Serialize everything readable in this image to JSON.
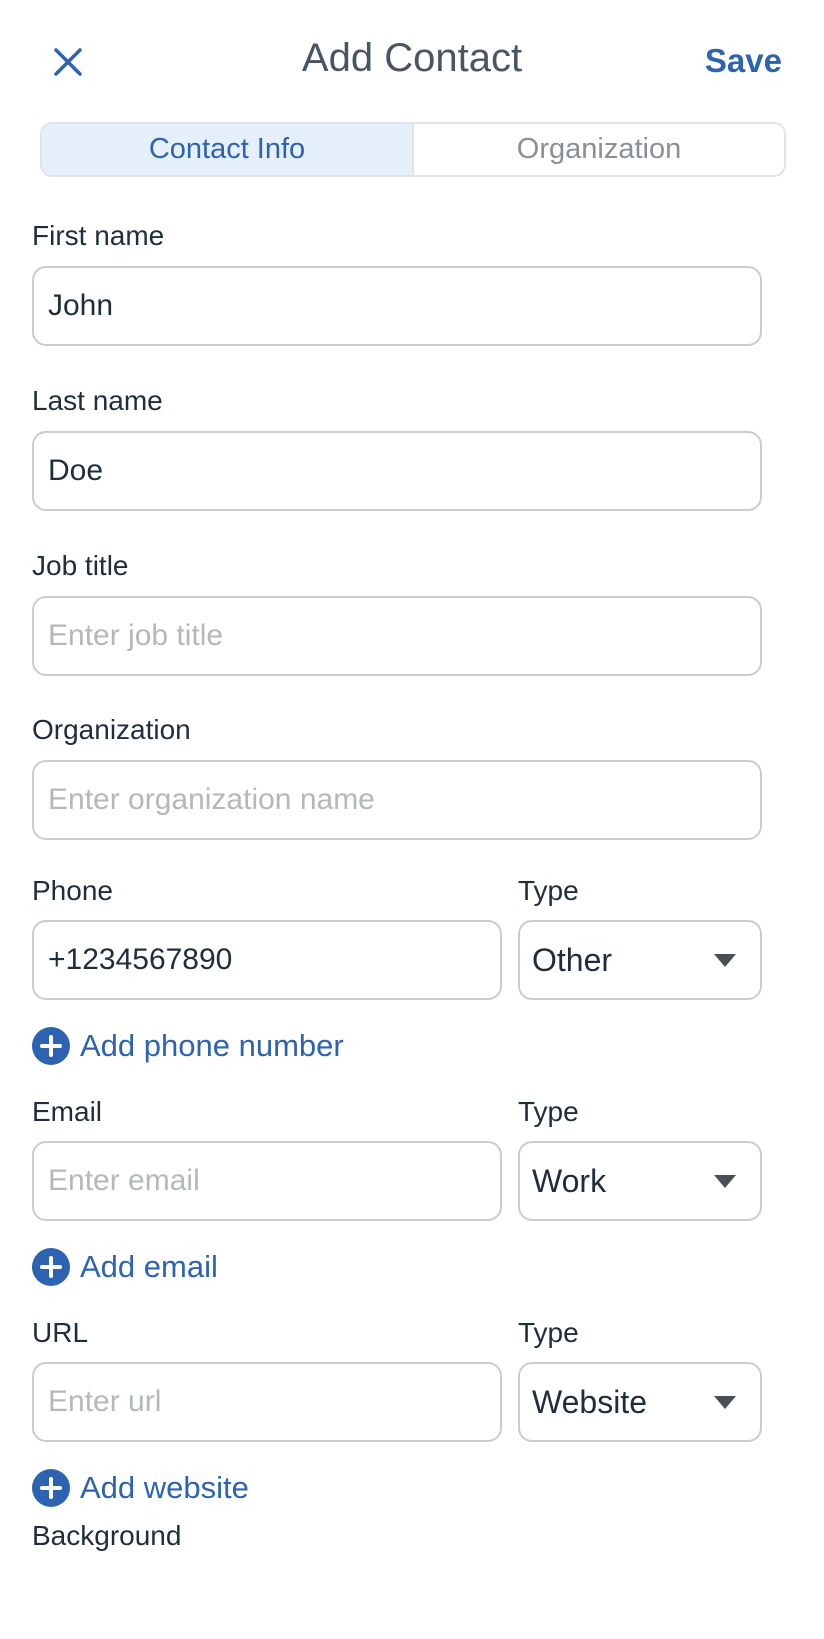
{
  "header": {
    "close_icon": "close-icon",
    "title": "Add Contact",
    "save_label": "Save"
  },
  "tabs": [
    {
      "label": "Contact Info",
      "active": true
    },
    {
      "label": "Organization",
      "active": false
    }
  ],
  "fields": {
    "first_name": {
      "label": "First name",
      "value": "John"
    },
    "last_name": {
      "label": "Last name",
      "value": "Doe"
    },
    "job_title": {
      "label": "Job title",
      "placeholder": "Enter job title"
    },
    "organization": {
      "label": "Organization",
      "placeholder": "Enter organization name"
    },
    "phone": {
      "label": "Phone",
      "value": "+1234567890",
      "type_label": "Type",
      "type_value": "Other",
      "add_label": "Add phone number"
    },
    "email": {
      "label": "Email",
      "placeholder": "Enter email",
      "type_label": "Type",
      "type_value": "Work",
      "add_label": "Add email"
    },
    "url": {
      "label": "URL",
      "placeholder": "Enter url",
      "type_label": "Type",
      "type_value": "Website",
      "add_label": "Add website"
    },
    "background": {
      "label": "Background"
    }
  },
  "colors": {
    "accent": "#2e63b1",
    "active_tab_bg": "#e6f0fd",
    "border": "#c9ccd1",
    "placeholder": "#b4b8be"
  }
}
